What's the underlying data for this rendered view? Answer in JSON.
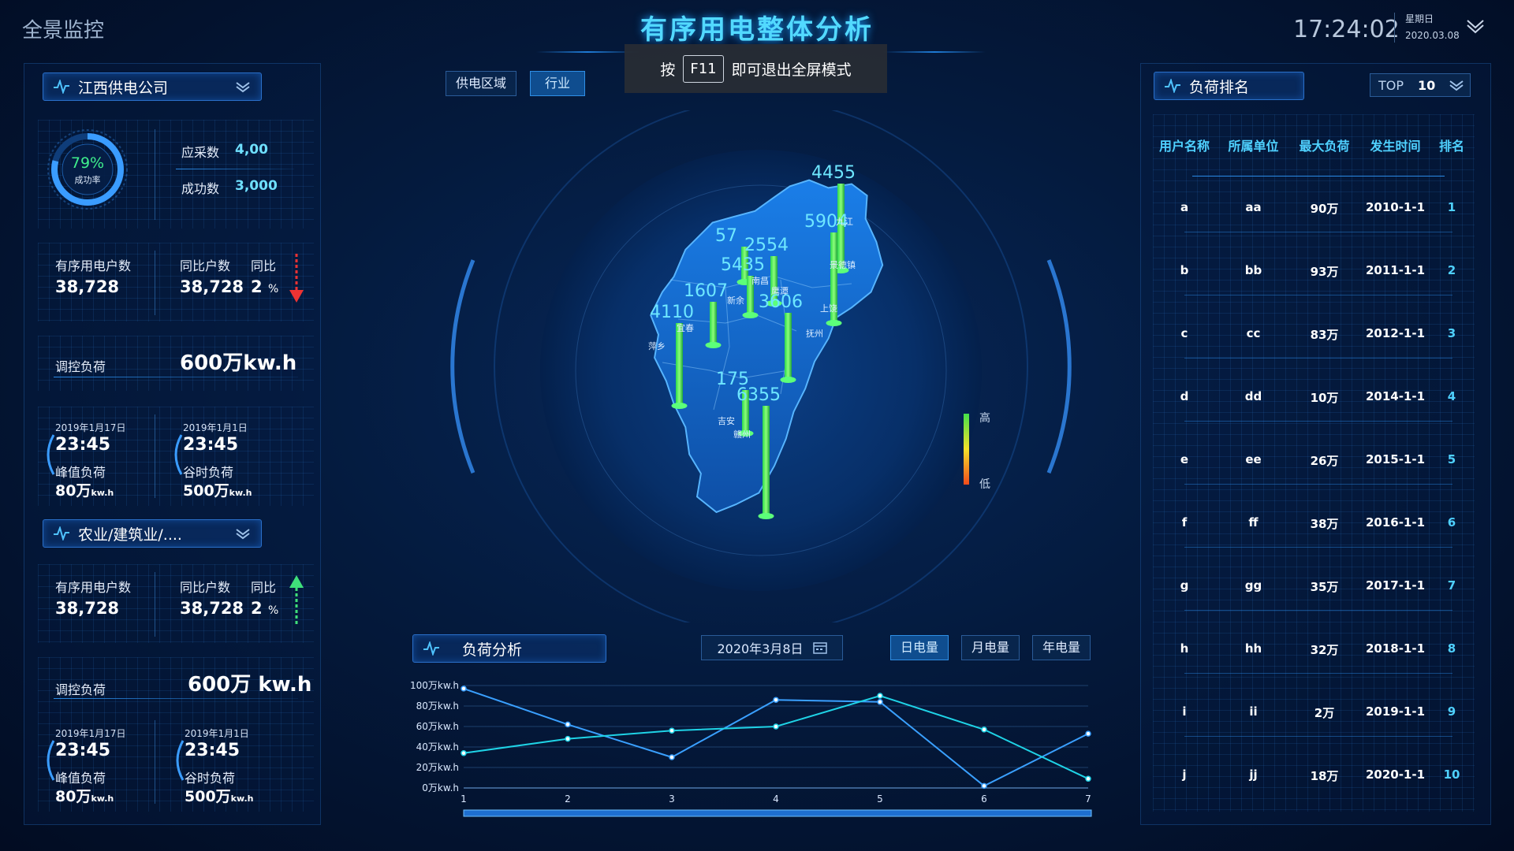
{
  "header": {
    "left_title": "全景监控",
    "title": "有序用电整体分析",
    "tip_prefix": "按",
    "tip_key": "F11",
    "tip_suffix": "即可退出全屏模式",
    "time": "17:24:02",
    "weekday": "星期日",
    "date": "2020.03.08"
  },
  "company_panel": {
    "title": "江西供电公司",
    "rate": "79%",
    "rate_value": 0.79,
    "rate_label": "成功率",
    "should_collect_label": "应采数",
    "should_collect_value": "4,00",
    "success_label": "成功数",
    "success_value": "3,000",
    "households_label": "有序用电户数",
    "households_value": "38,728",
    "yoy_households_label": "同比户数",
    "yoy_households_value": "38,728",
    "yoy_label": "同比",
    "yoy_value": "2",
    "yoy_unit": "%",
    "control_load_label": "调控负荷",
    "control_load_value": "600万kw.h",
    "peak_date": "2019年1月17日",
    "peak_time": "23:45",
    "peak_label": "峰值负荷",
    "peak_value": "80万",
    "peak_unit": "kw.h",
    "valley_date": "2019年1月1日",
    "valley_time": "23:45",
    "valley_label": "谷时负荷",
    "valley_value": "500万",
    "valley_unit": "kw.h"
  },
  "industry_panel": {
    "title": "农业/建筑业/....",
    "households_label": "有序用电户数",
    "households_value": "38,728",
    "yoy_households_label": "同比户数",
    "yoy_households_value": "38,728",
    "yoy_label": "同比",
    "yoy_value": "2",
    "yoy_unit": "%",
    "control_load_label": "调控负荷",
    "control_load_value": "600万 kw.h",
    "peak_date": "2019年1月17日",
    "peak_time": "23:45",
    "peak_label": "峰值负荷",
    "peak_value": "80万",
    "peak_unit": "kw.h",
    "valley_date": "2019年1月1日",
    "valley_time": "23:45",
    "valley_label": "谷时负荷",
    "valley_value": "500万",
    "valley_unit": "kw.h"
  },
  "map_tabs": [
    "供电区域",
    "行业"
  ],
  "map": {
    "legend_high": "高",
    "legend_low": "低",
    "values": [
      "4455",
      "5904",
      "57",
      "2554",
      "5435",
      "1607",
      "3606",
      "4110",
      "175",
      "6355"
    ],
    "cities": [
      "九江",
      "景德镇",
      "南昌",
      "鹰潭",
      "宜春",
      "抚州",
      "萍乡",
      "新余",
      "吉安",
      "上饶",
      "赣州"
    ]
  },
  "ranking": {
    "title": "负荷排名",
    "top_label": "TOP",
    "top_value": "10",
    "columns": [
      "用户名称",
      "所属单位",
      "最大负荷",
      "发生时间",
      "排名"
    ],
    "rows": [
      [
        "a",
        "aa",
        "90万",
        "2010-1-1",
        "1"
      ],
      [
        "b",
        "bb",
        "93万",
        "2011-1-1",
        "2"
      ],
      [
        "c",
        "cc",
        "83万",
        "2012-1-1",
        "3"
      ],
      [
        "d",
        "dd",
        "10万",
        "2014-1-1",
        "4"
      ],
      [
        "e",
        "ee",
        "26万",
        "2015-1-1",
        "5"
      ],
      [
        "f",
        "ff",
        "38万",
        "2016-1-1",
        "6"
      ],
      [
        "g",
        "gg",
        "35万",
        "2017-1-1",
        "7"
      ],
      [
        "h",
        "hh",
        "32万",
        "2018-1-1",
        "8"
      ],
      [
        "i",
        "ii",
        "2万",
        "2019-1-1",
        "9"
      ],
      [
        "j",
        "jj",
        "18万",
        "2020-1-1",
        "10"
      ]
    ]
  },
  "load_analysis": {
    "title": "负荷分析",
    "date_value": "2020年3月8日",
    "buttons": [
      "日电量",
      "月电量",
      "年电量"
    ]
  },
  "chart_data": {
    "type": "line",
    "x": [
      1,
      2,
      3,
      4,
      5,
      6,
      7
    ],
    "yticks": [
      "0万kw.h",
      "20万kw.h",
      "40万kw.h",
      "60万kw.h",
      "80万kw.h",
      "100万kw.h"
    ],
    "ylim": [
      0,
      100
    ],
    "series": [
      {
        "color": "#3aa0ff",
        "values": [
          97,
          62,
          30,
          86,
          84,
          2,
          53
        ]
      },
      {
        "color": "#1fd3e6",
        "values": [
          34,
          48,
          56,
          60,
          90,
          57,
          9
        ]
      }
    ],
    "grid": true
  }
}
